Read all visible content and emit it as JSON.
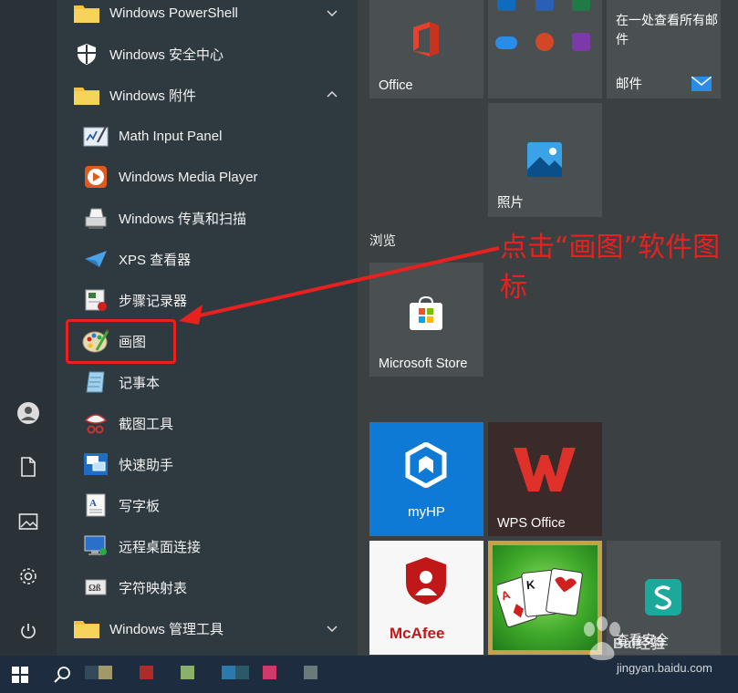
{
  "app_list": {
    "rows": [
      {
        "label": "Windows PowerShell"
      },
      {
        "label": "Windows 安全中心"
      },
      {
        "label": "Windows 附件"
      },
      {
        "label": "Math Input Panel"
      },
      {
        "label": "Windows Media Player"
      },
      {
        "label": "Windows 传真和扫描"
      },
      {
        "label": "XPS 查看器"
      },
      {
        "label": "步骤记录器"
      },
      {
        "label": "画图"
      },
      {
        "label": "记事本"
      },
      {
        "label": "截图工具"
      },
      {
        "label": "快速助手"
      },
      {
        "label": "写字板"
      },
      {
        "label": "远程桌面连接"
      },
      {
        "label": "字符映射表"
      },
      {
        "label": "Windows 管理工具"
      }
    ]
  },
  "tiles": {
    "office": "Office",
    "mail_title": "在一处查看所有邮件",
    "mail": "邮件",
    "photos": "照片",
    "group_browse": "浏览",
    "store": "Microsoft Store",
    "myhp": "myHP",
    "wps": "WPS Office",
    "mcafee": "McAfee",
    "bottom_right": "查看安全"
  },
  "annotation": {
    "text": "点击“画图”软件图标"
  },
  "watermark": {
    "brand": "Bai经验",
    "url": "jingyan.baidu.com"
  },
  "colors": {
    "annotation_red": "#e8211f",
    "myhp_blue": "#0f7ad6",
    "wps_bg": "#3b2a2a",
    "mcafee_red": "#c01818"
  }
}
